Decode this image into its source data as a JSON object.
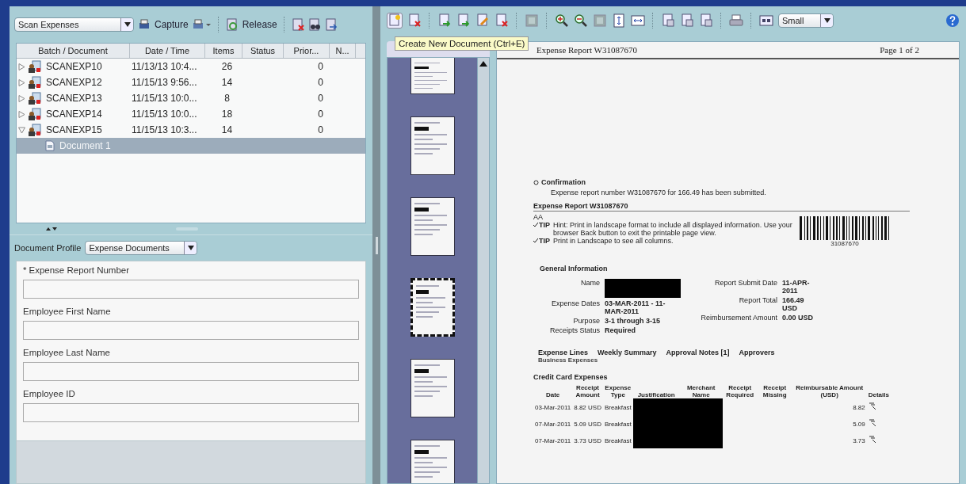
{
  "capture_toolbar": {
    "batch_class": "Scan Expenses",
    "capture_label": "Capture",
    "release_label": "Release"
  },
  "batch_table": {
    "columns": [
      "Batch / Document",
      "Date / Time",
      "Items",
      "Status",
      "Prior...",
      "N..."
    ],
    "rows": [
      {
        "name": "SCANEXP10",
        "date_time": "11/13/13 10:4...",
        "items": "26",
        "priority": "0",
        "expanded": false,
        "selected": false,
        "children": []
      },
      {
        "name": "SCANEXP12",
        "date_time": "11/15/13 9:56...",
        "items": "14",
        "priority": "0",
        "expanded": false,
        "selected": false,
        "children": []
      },
      {
        "name": "SCANEXP13",
        "date_time": "11/15/13 10:0...",
        "items": "8",
        "priority": "0",
        "expanded": false,
        "selected": false,
        "children": []
      },
      {
        "name": "SCANEXP14",
        "date_time": "11/15/13 10:0...",
        "items": "18",
        "priority": "0",
        "expanded": false,
        "selected": false,
        "children": []
      },
      {
        "name": "SCANEXP15",
        "date_time": "11/15/13 10:3...",
        "items": "14",
        "priority": "0",
        "expanded": true,
        "selected": false,
        "children": [
          {
            "name": "Document 1",
            "selected": true
          }
        ]
      }
    ]
  },
  "document_profile": {
    "label": "Document Profile",
    "value": "Expense Documents"
  },
  "fields": [
    {
      "required_mark": "*",
      "label": "Expense Report Number"
    },
    {
      "label": "Employee First Name"
    },
    {
      "label": "Employee Last Name"
    },
    {
      "label": "Employee ID"
    }
  ],
  "viewer_toolbar": {
    "size_select": "Small"
  },
  "tooltip": "Create New Document (Ctrl+E)",
  "thumbnails": [
    {
      "selected": false
    },
    {
      "selected": false
    },
    {
      "selected": false
    },
    {
      "selected": true
    },
    {
      "selected": false
    },
    {
      "selected": false
    }
  ],
  "document": {
    "title": "Expense Report W31087670",
    "page": "Page 1 of 2",
    "confirmation_title": "Confirmation",
    "confirmation_text": "Expense report number W31087670 for 166.49 has been submitted.",
    "report_heading": "Expense Report W31087670",
    "initials": "AA",
    "tips": [
      {
        "tag": "TIP",
        "text": "Hint: Print in landscape format to include all displayed information. Use your browser Back button to exit the printable page view."
      },
      {
        "tag": "TIP",
        "text": "Print in Landscape to see all columns."
      }
    ],
    "barcode_number": "31087670",
    "general_heading": "General Information",
    "info_left": [
      {
        "label": "Name",
        "redacted": true
      },
      {
        "label": "Expense Dates",
        "value": "03-MAR-2011 - 11-MAR-2011",
        "redacted": false
      },
      {
        "label": "Purpose",
        "value": "3-1 through 3-15",
        "redacted": false
      },
      {
        "label": "Receipts Status",
        "value": "Required",
        "redacted": false
      }
    ],
    "info_right": [
      {
        "label": "Report Submit Date",
        "value": "11-APR-2011"
      },
      {
        "label": "Report Total",
        "value": "166.49 USD"
      },
      {
        "label": "Reimbursement Amount",
        "value": "0.00 USD"
      }
    ],
    "tabs": [
      "Expense Lines",
      "Weekly Summary",
      "Approval Notes [1]",
      "Approvers"
    ],
    "section_label": "Business Expenses",
    "table_heading": "Credit Card Expenses",
    "columns": [
      "Date",
      "Receipt Amount",
      "Expense Type",
      "Justification",
      "Merchant Name",
      "Receipt Required",
      "Receipt Missing",
      "Reimbursable Amount (USD)",
      "Details"
    ],
    "rows": [
      {
        "date": "03-Mar-2011",
        "amount": "8.82 USD",
        "type": "Breakfast",
        "redacted": true,
        "reimbursable": "8.82"
      },
      {
        "date": "07-Mar-2011",
        "amount": "5.09 USD",
        "type": "Breakfast",
        "redacted": true,
        "reimbursable": "5.09"
      },
      {
        "date": "07-Mar-2011",
        "amount": "3.73 USD",
        "type": "Breakfast",
        "redacted": true,
        "reimbursable": "3.73"
      }
    ]
  }
}
